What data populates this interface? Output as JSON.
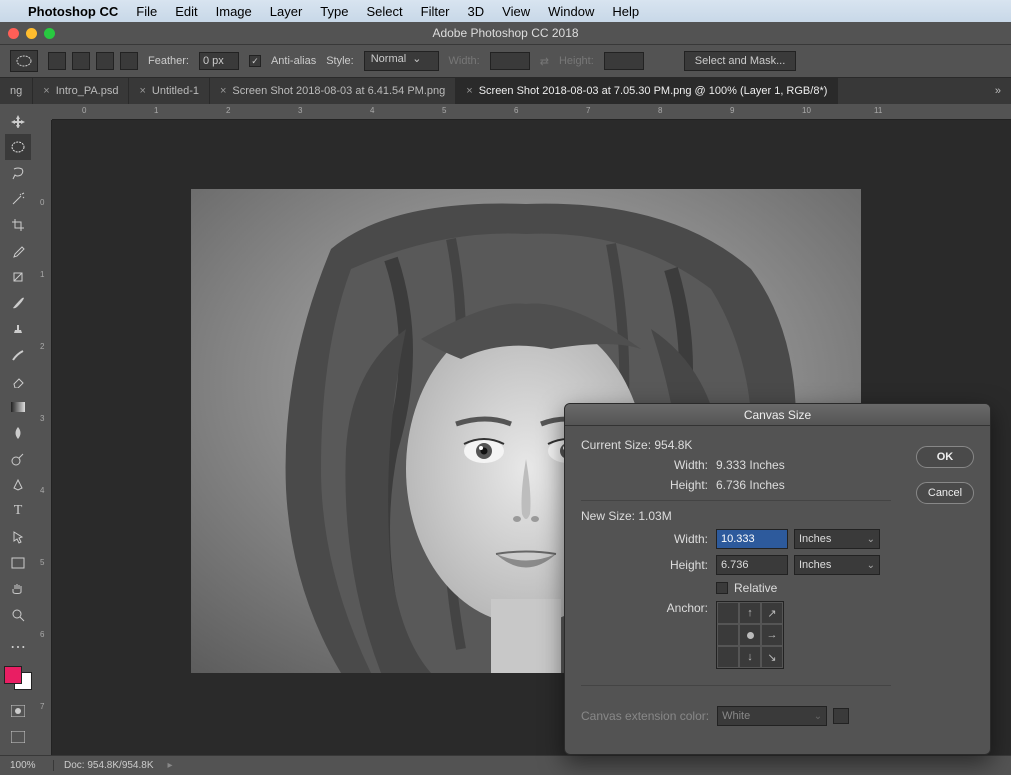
{
  "menubar": {
    "app": "Photoshop CC",
    "items": [
      "File",
      "Edit",
      "Image",
      "Layer",
      "Type",
      "Select",
      "Filter",
      "3D",
      "View",
      "Window",
      "Help"
    ]
  },
  "window_title": "Adobe Photoshop CC 2018",
  "options": {
    "feather_label": "Feather:",
    "feather_value": "0 px",
    "antialias_label": "Anti-alias",
    "style_label": "Style:",
    "style_value": "Normal",
    "width_label": "Width:",
    "height_label": "Height:",
    "mask_btn": "Select and Mask..."
  },
  "tabs": [
    {
      "label": "ng"
    },
    {
      "label": "Intro_PA.psd"
    },
    {
      "label": "Untitled-1"
    },
    {
      "label": "Screen Shot 2018-08-03 at 6.41.54 PM.png"
    },
    {
      "label": "Screen Shot 2018-08-03 at 7.05.30 PM.png @ 100% (Layer 1, RGB/8*)"
    }
  ],
  "active_tab": 4,
  "ruler_h": [
    "0",
    "1",
    "2",
    "3",
    "4",
    "5",
    "6",
    "7",
    "8",
    "9",
    "10",
    "11"
  ],
  "ruler_v": [
    "0",
    "1",
    "2",
    "3",
    "4",
    "5",
    "6",
    "7"
  ],
  "status": {
    "zoom": "100%",
    "doc": "Doc: 954.8K/954.8K"
  },
  "dialog": {
    "title": "Canvas Size",
    "current_label": "Current Size: 954.8K",
    "cur_width_label": "Width:",
    "cur_width_value": "9.333 Inches",
    "cur_height_label": "Height:",
    "cur_height_value": "6.736 Inches",
    "new_label": "New Size: 1.03M",
    "new_width_label": "Width:",
    "new_width_value": "10.333",
    "new_height_label": "Height:",
    "new_height_value": "6.736",
    "unit": "Inches",
    "relative_label": "Relative",
    "anchor_label": "Anchor:",
    "ext_label": "Canvas extension color:",
    "ext_value": "White",
    "ok": "OK",
    "cancel": "Cancel"
  }
}
